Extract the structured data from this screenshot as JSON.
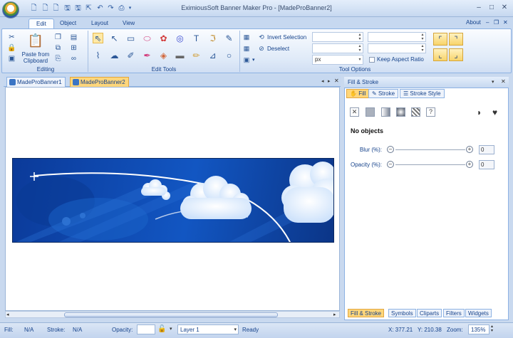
{
  "window": {
    "title": "EximiousSoft Banner Maker Pro - [MadeProBanner2]",
    "min": "–",
    "max": "□",
    "close": "✕"
  },
  "ribbon_tabs": [
    "Edit",
    "Object",
    "Layout",
    "View"
  ],
  "ribbon_right": {
    "about": "About",
    "min": "–",
    "restore": "❐",
    "close": "✕"
  },
  "groups": {
    "editing": {
      "label": "Editing",
      "paste_line1": "Paste from",
      "paste_line2": "Clipboard"
    },
    "edit_tools": {
      "label": "Edit Tools"
    },
    "tool_options": {
      "label": "Tool Options",
      "invert_selection": "Invert Selection",
      "deselect": "Deselect",
      "unit": "px",
      "keep_aspect": "Keep Aspect Ratio"
    }
  },
  "documents": [
    "MadeProBanner1",
    "MadeProBanner2"
  ],
  "panel": {
    "title": "Fill & Stroke",
    "tabs": [
      "Fill",
      "Stroke",
      "Stroke Style"
    ],
    "no_objects": "No objects",
    "blur_label": "Blur (%):",
    "blur_value": "0",
    "opacity_label": "Opacity (%):",
    "opacity_value": "0",
    "bottom_tabs": [
      "Fill & Stroke",
      "Symbols",
      "Cliparts",
      "Filters",
      "Widgets"
    ]
  },
  "status": {
    "fill_label": "Fill:",
    "fill_value": "N/A",
    "stroke_label": "Stroke:",
    "stroke_value": "N/A",
    "opacity_label": "Opacity:",
    "layer": "Layer 1",
    "ready": "Ready",
    "x": "X: 377.21",
    "y": "Y: 210.38",
    "zoom_label": "Zoom:",
    "zoom_value": "135%"
  },
  "colors": {
    "accent": "#15428b",
    "active_tab": "#ffd67a",
    "banner_blue": "#1256c2"
  }
}
